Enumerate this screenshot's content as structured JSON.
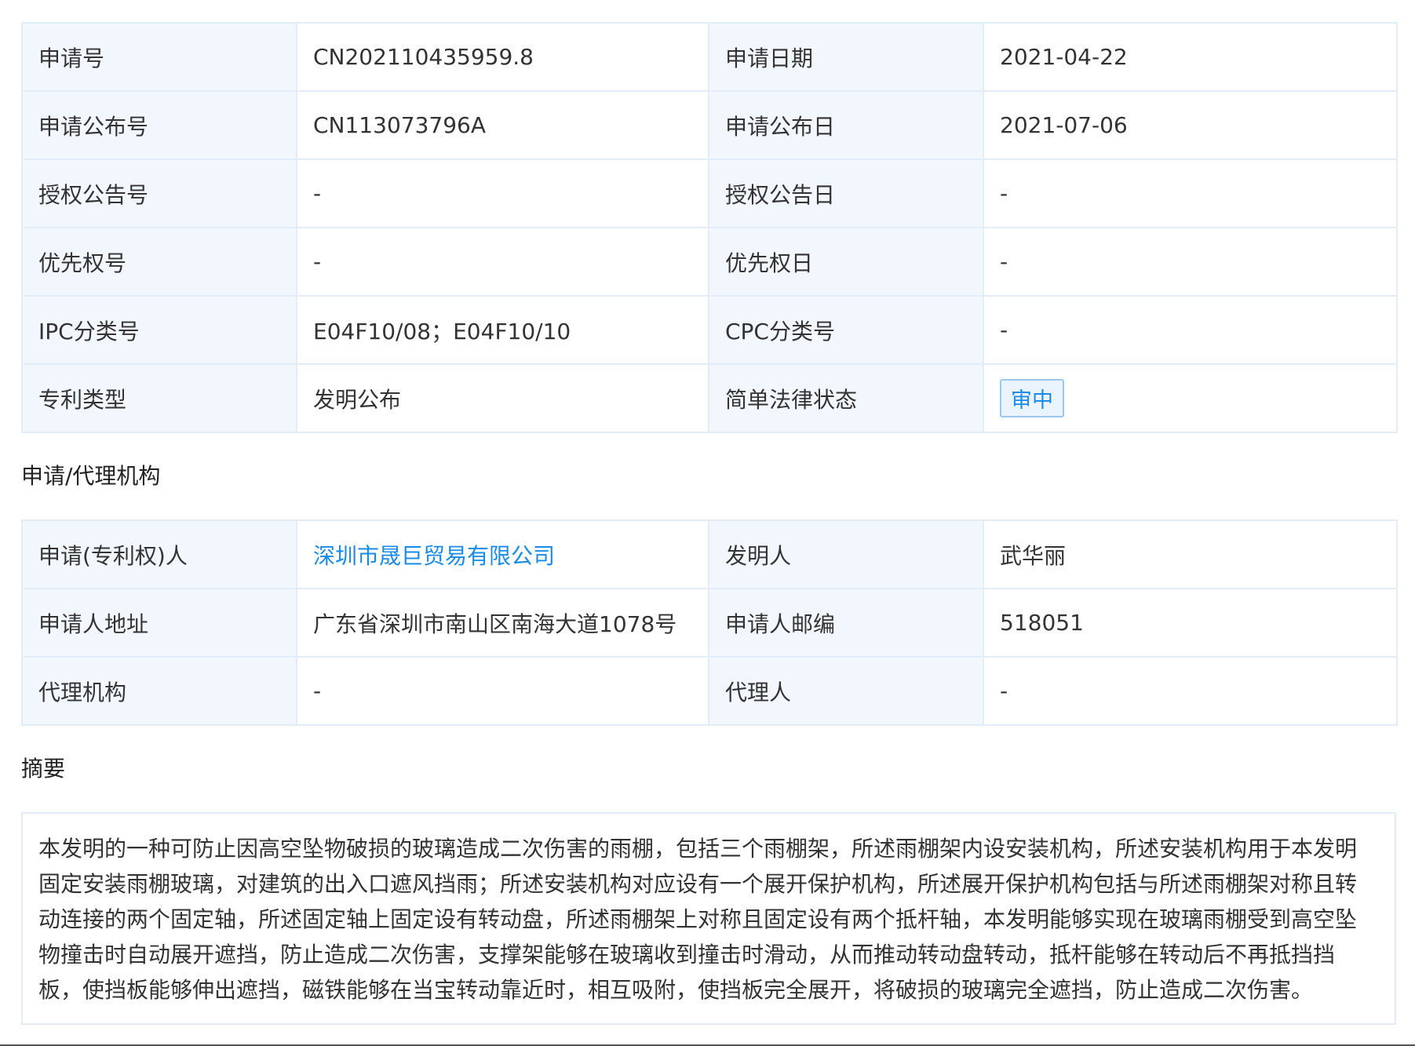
{
  "basic_info": {
    "rows": [
      {
        "k1": "申请号",
        "v1": "CN202110435959.8",
        "k2": "申请日期",
        "v2": "2021-04-22"
      },
      {
        "k1": "申请公布号",
        "v1": "CN113073796A",
        "k2": "申请公布日",
        "v2": "2021-07-06"
      },
      {
        "k1": "授权公告号",
        "v1": "-",
        "k2": "授权公告日",
        "v2": "-"
      },
      {
        "k1": "优先权号",
        "v1": "-",
        "k2": "优先权日",
        "v2": "-"
      },
      {
        "k1": "IPC分类号",
        "v1": "E04F10/08；E04F10/10",
        "k2": "CPC分类号",
        "v2": "-"
      },
      {
        "k1": "专利类型",
        "v1": "发明公布",
        "k2": "简单法律状态",
        "v2": "审中"
      }
    ]
  },
  "agency_section": {
    "title": "申请/代理机构",
    "rows": [
      {
        "k1": "申请(专利权)人",
        "v1": "深圳市晟巨贸易有限公司",
        "k2": "发明人",
        "v2": "武华丽"
      },
      {
        "k1": "申请人地址",
        "v1": "广东省深圳市南山区南海大道1078号",
        "k2": "申请人邮编",
        "v2": "518051"
      },
      {
        "k1": "代理机构",
        "v1": "-",
        "k2": "代理人",
        "v2": "-"
      }
    ]
  },
  "abstract_section": {
    "title": "摘要",
    "text": "本发明的一种可防止因高空坠物破损的玻璃造成二次伤害的雨棚，包括三个雨棚架，所述雨棚架内设安装机构，所述安装机构用于本发明固定安装雨棚玻璃，对建筑的出入口遮风挡雨；所述安装机构对应设有一个展开保护机构，所述展开保护机构包括与所述雨棚架对称且转动连接的两个固定轴，所述固定轴上固定设有转动盘，所述雨棚架上对称且固定设有两个抵杆轴，本发明能够实现在玻璃雨棚受到高空坠物撞击时自动展开遮挡，防止造成二次伤害，支撑架能够在玻璃收到撞击时滑动，从而推动转动盘转动，抵杆能够在转动后不再抵挡挡板，使挡板能够伸出遮挡，磁铁能够在当宝转动靠近时，相互吸附，使挡板完全展开，将破损的玻璃完全遮挡，防止造成二次伤害。"
  },
  "colors": {
    "label_bg": "#f1f7fd",
    "border": "#e3edf7",
    "link": "#1a8be6"
  }
}
